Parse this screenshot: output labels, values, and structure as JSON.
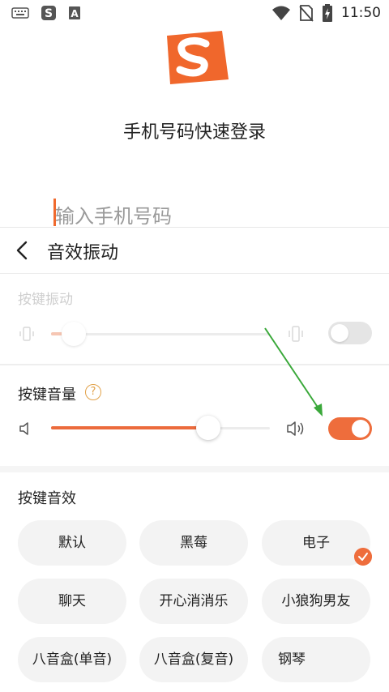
{
  "status_bar": {
    "time": "11:50",
    "icons": [
      "keyboard-icon",
      "sogou-icon",
      "a-box-icon",
      "wifi-icon",
      "no-sim-icon",
      "battery-charging-icon"
    ]
  },
  "login": {
    "title": "手机号码快速登录",
    "phone_placeholder": "输入手机号码"
  },
  "sheet": {
    "title": "音效振动",
    "vibration": {
      "label": "按键振动",
      "level": 0.03,
      "enabled": false
    },
    "volume": {
      "label": "按键音量",
      "level": 0.7,
      "enabled": true
    },
    "effects": {
      "label": "按键音效",
      "items": [
        {
          "label": "默认",
          "selected": false
        },
        {
          "label": "黑莓",
          "selected": false
        },
        {
          "label": "电子",
          "selected": true
        },
        {
          "label": "聊天",
          "selected": false
        },
        {
          "label": "开心消消乐",
          "selected": false
        },
        {
          "label": "小狼狗男友",
          "selected": false
        },
        {
          "label": "八音盒(单音)",
          "selected": false
        },
        {
          "label": "八音盒(复音)",
          "selected": false
        },
        {
          "label": "钢琴",
          "selected": false
        }
      ]
    }
  },
  "colors": {
    "accent": "#ee6d3c",
    "annotation_arrow": "#3aa83a"
  }
}
